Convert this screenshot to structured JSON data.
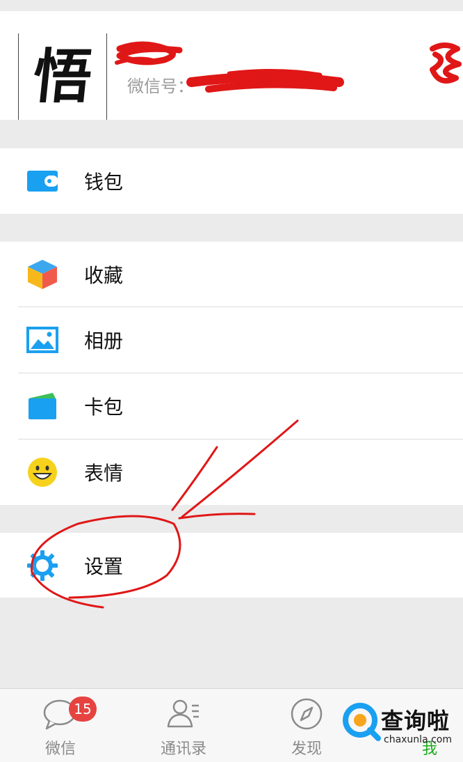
{
  "profile": {
    "avatar_char": "悟",
    "wechat_id_label": "微信号："
  },
  "menu": {
    "wallet": "钱包",
    "favorites": "收藏",
    "album": "相册",
    "cards": "卡包",
    "stickers": "表情",
    "settings": "设置"
  },
  "tabbar": {
    "chats": "微信",
    "chats_badge": "15",
    "contacts": "通讯录",
    "discover": "发现",
    "me": "我"
  },
  "watermark": {
    "name": "查询啦",
    "domain": "chaxunla.com"
  },
  "colors": {
    "background": "#ebebeb",
    "badge": "#e64340",
    "annotation": "#e01717",
    "icon_blue": "#1aa0f0"
  }
}
